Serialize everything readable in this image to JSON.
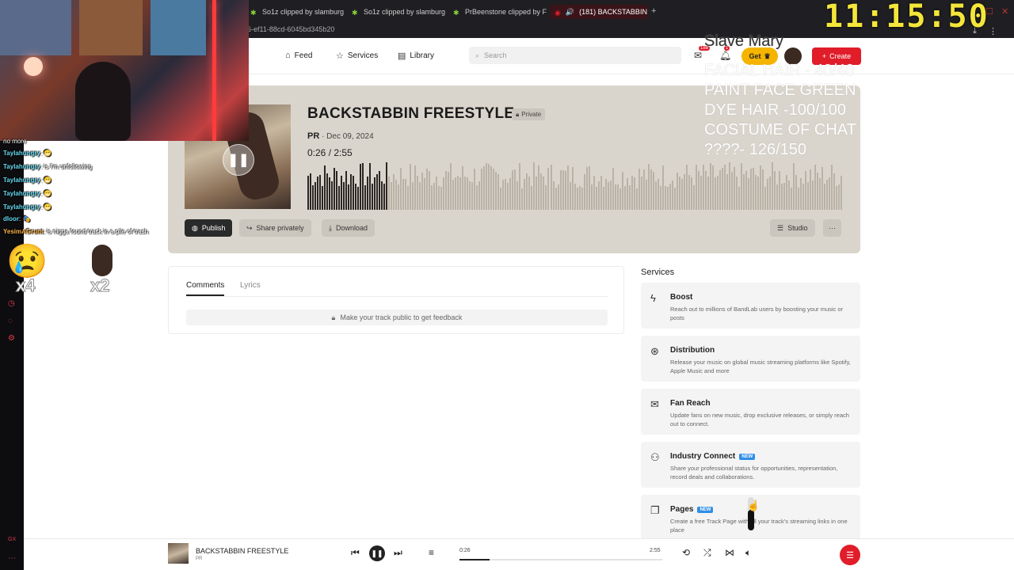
{
  "browser": {
    "tabs": [
      {
        "label": "So1z clipped by slamburg",
        "color": "#8ad33a"
      },
      {
        "label": "So1z clipped by slamburg",
        "color": "#8ad33a"
      },
      {
        "label": "PrBeenstone clipped by F",
        "color": "#8ad33a"
      },
      {
        "label": "(181) BACKSTABBIN F",
        "color": "#e11d2a"
      }
    ],
    "url_fragment": "6-ef11-88cd-6045bd345b20"
  },
  "overlay": {
    "clock": "11:15:50",
    "note_title": "Slave Mary",
    "note_lines": [
      "FACIAL HAIR - 40/40",
      "PAINT FACE GREEN",
      "DYE HAIR -100/100",
      "COSTUME OF CHAT",
      "????- 126/150"
    ],
    "chat_header": "no more",
    "chat": [
      {
        "user": "Taylahungry",
        "msg": ": 😁"
      },
      {
        "user": "Taylahungry",
        "msg": ": is I'm unfollowing"
      },
      {
        "user": "Taylahungry",
        "msg": ": 😁"
      },
      {
        "user": "Taylahungry",
        "msg": ": 😁"
      },
      {
        "user": "Taylahungry",
        "msg": ": 😁"
      },
      {
        "user": "dloor",
        "msg": ": 🎭"
      },
      {
        "user": "YesimAGrunt",
        "msg": ": is nigga found track in a pile of trash"
      }
    ],
    "emote_counts": [
      "x4",
      "x2"
    ]
  },
  "nav": {
    "feed": "Feed",
    "services": "Services",
    "library": "Library",
    "search_placeholder": "Search",
    "messages_badge": "188",
    "notifications_badge": "1",
    "get_label": "Get",
    "create_label": "Create"
  },
  "track": {
    "title": "BACKSTABBIN FREESTYLE",
    "privacy": "Private",
    "artist": "PR",
    "date": "Dec 09, 2024",
    "current_time": "0:26",
    "duration": "2:55",
    "progress": 0.148,
    "publish_label": "Publish",
    "share_label": "Share privately",
    "download_label": "Download",
    "studio_label": "Studio"
  },
  "comments": {
    "tab_comments": "Comments",
    "tab_lyrics": "Lyrics",
    "locked_message": "Make your track public to get feedback"
  },
  "services": {
    "title": "Services",
    "items": [
      {
        "icon": "bolt-icon",
        "title": "Boost",
        "is_new": false,
        "desc": "Reach out to millions of BandLab users by boosting your music or posts"
      },
      {
        "icon": "distribution-icon",
        "title": "Distribution",
        "is_new": false,
        "desc": "Release your music on global music streaming platforms like Spotify, Apple Music and more"
      },
      {
        "icon": "mail-icon",
        "title": "Fan Reach",
        "is_new": false,
        "desc": "Update fans on new music, drop exclusive releases, or simply reach out to connect."
      },
      {
        "icon": "people-icon",
        "title": "Industry Connect",
        "is_new": true,
        "desc": "Share your professional status for opportunities, representation, record deals and collaborations."
      },
      {
        "icon": "pages-icon",
        "title": "Pages",
        "is_new": true,
        "desc": "Create a free Track Page with all your track's streaming links in one place"
      }
    ],
    "new_label": "NEW"
  },
  "player": {
    "title": "BACKSTABBIN FREESTYLE",
    "artist": "PR",
    "current_time": "0:26",
    "duration": "2:55",
    "progress": 0.148,
    "volume": 0.62
  },
  "colors": {
    "brand_red": "#e11d2a",
    "card_bg": "#dad5cc",
    "get_yellow": "#f5b400",
    "new_badge": "#2f8ee8"
  }
}
